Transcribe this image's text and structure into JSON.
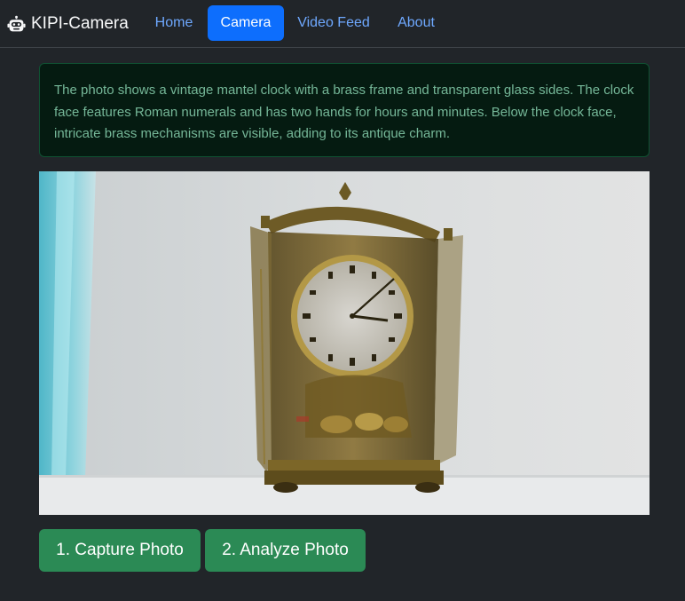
{
  "brand": {
    "name": "KIPI-Camera",
    "icon": "robot-icon"
  },
  "nav": {
    "items": [
      {
        "label": "Home",
        "active": false
      },
      {
        "label": "Camera",
        "active": true
      },
      {
        "label": "Video Feed",
        "active": false
      },
      {
        "label": "About",
        "active": false
      }
    ]
  },
  "alert": {
    "text": "The photo shows a vintage mantel clock with a brass frame and transparent glass sides. The clock face features Roman numerals and has two hands for hours and minutes. Below the clock face, intricate brass mechanisms are visible, adding to its antique charm."
  },
  "actions": {
    "capture_label": "1. Capture Photo",
    "analyze_label": "2. Analyze Photo"
  },
  "colors": {
    "background": "#212529",
    "nav_link": "#6ea8fe",
    "nav_active": "#0d6efd",
    "alert_bg": "#051b11",
    "alert_border": "#0f5132",
    "alert_text": "#75b798",
    "button": "#2b8a55"
  }
}
